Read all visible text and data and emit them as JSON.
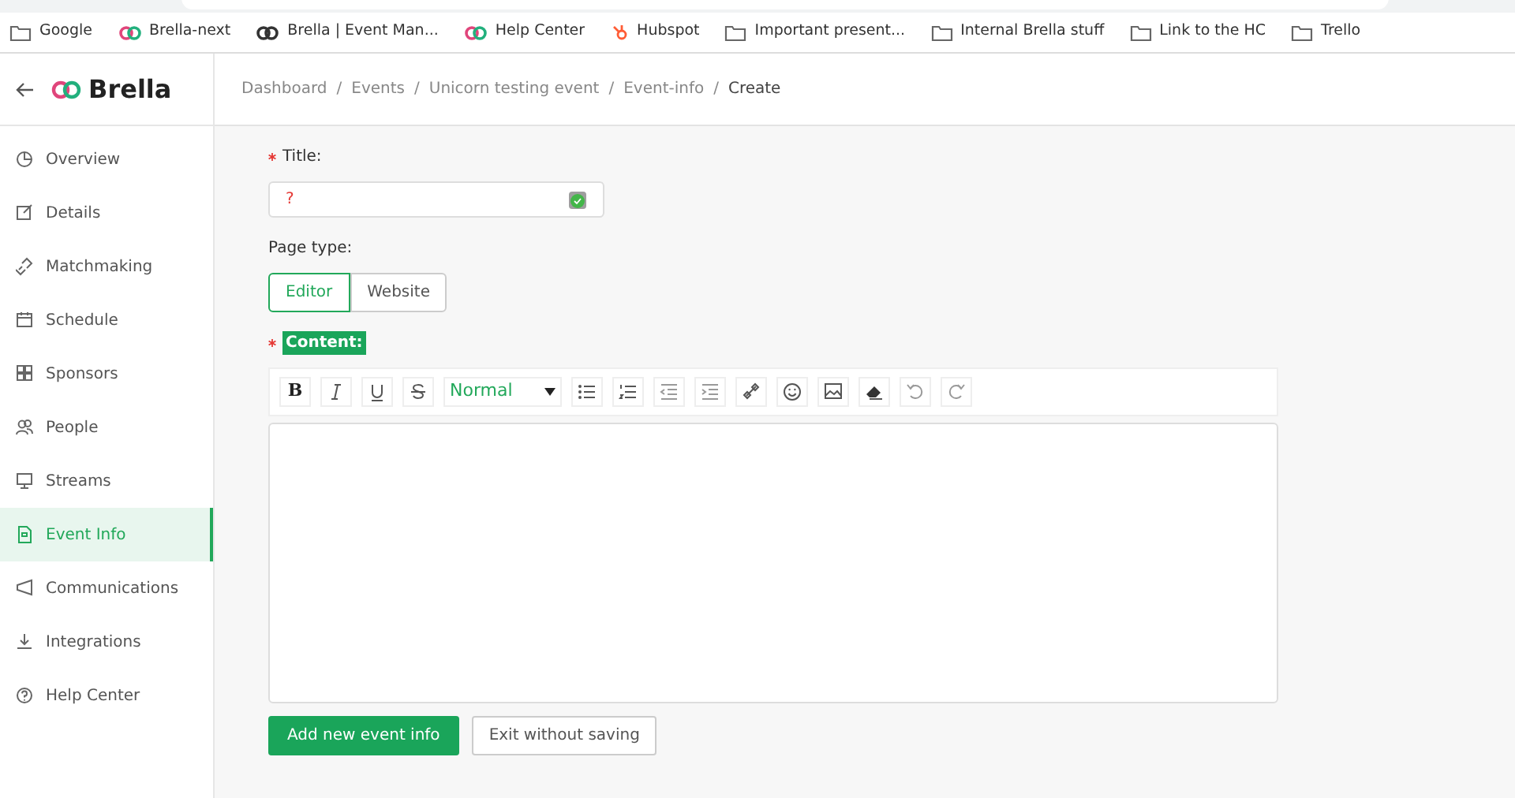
{
  "bookmarks": [
    {
      "label": "Google",
      "kind": "folder"
    },
    {
      "label": "Brella-next",
      "kind": "brella"
    },
    {
      "label": "Brella | Event Man...",
      "kind": "brella-dark"
    },
    {
      "label": "Help Center",
      "kind": "brella"
    },
    {
      "label": "Hubspot",
      "kind": "hubspot"
    },
    {
      "label": "Important present...",
      "kind": "folder"
    },
    {
      "label": "Internal Brella stuff",
      "kind": "folder"
    },
    {
      "label": "Link to the HC",
      "kind": "folder"
    },
    {
      "label": "Trello",
      "kind": "folder"
    }
  ],
  "brand": "Brella",
  "breadcrumb": {
    "separator": "/",
    "items": [
      "Dashboard",
      "Events",
      "Unicorn testing event",
      "Event-info",
      "Create"
    ]
  },
  "sidebar": {
    "items": [
      {
        "label": "Overview",
        "selected": false
      },
      {
        "label": "Details",
        "selected": false
      },
      {
        "label": "Matchmaking",
        "selected": false
      },
      {
        "label": "Schedule",
        "selected": false
      },
      {
        "label": "Sponsors",
        "selected": false
      },
      {
        "label": "People",
        "selected": false
      },
      {
        "label": "Streams",
        "selected": false
      },
      {
        "label": "Event Info",
        "selected": true
      },
      {
        "label": "Communications",
        "selected": false
      },
      {
        "label": "Integrations",
        "selected": false
      },
      {
        "label": "Help Center",
        "selected": false
      }
    ]
  },
  "form": {
    "title_label": "Title:",
    "title_value": "?",
    "page_type_label": "Page type:",
    "page_types": [
      {
        "label": "Editor",
        "selected": true
      },
      {
        "label": "Website",
        "selected": false
      }
    ],
    "content_label": "Content:",
    "toolbar": [
      {
        "kind": "bold",
        "label": "B"
      },
      {
        "kind": "italic"
      },
      {
        "kind": "underline"
      },
      {
        "kind": "strike"
      },
      {
        "kind": "dropdown",
        "label": "Normal"
      },
      {
        "kind": "bullets"
      },
      {
        "kind": "numbers"
      },
      {
        "kind": "outdent"
      },
      {
        "kind": "indent"
      },
      {
        "kind": "link"
      },
      {
        "kind": "emoji"
      },
      {
        "kind": "image"
      },
      {
        "kind": "clear"
      },
      {
        "kind": "undo"
      },
      {
        "kind": "redo"
      }
    ],
    "buttons": [
      {
        "label": "Add new event info",
        "kind": "primary"
      },
      {
        "label": "Exit without saving",
        "kind": "secondary"
      }
    ]
  }
}
